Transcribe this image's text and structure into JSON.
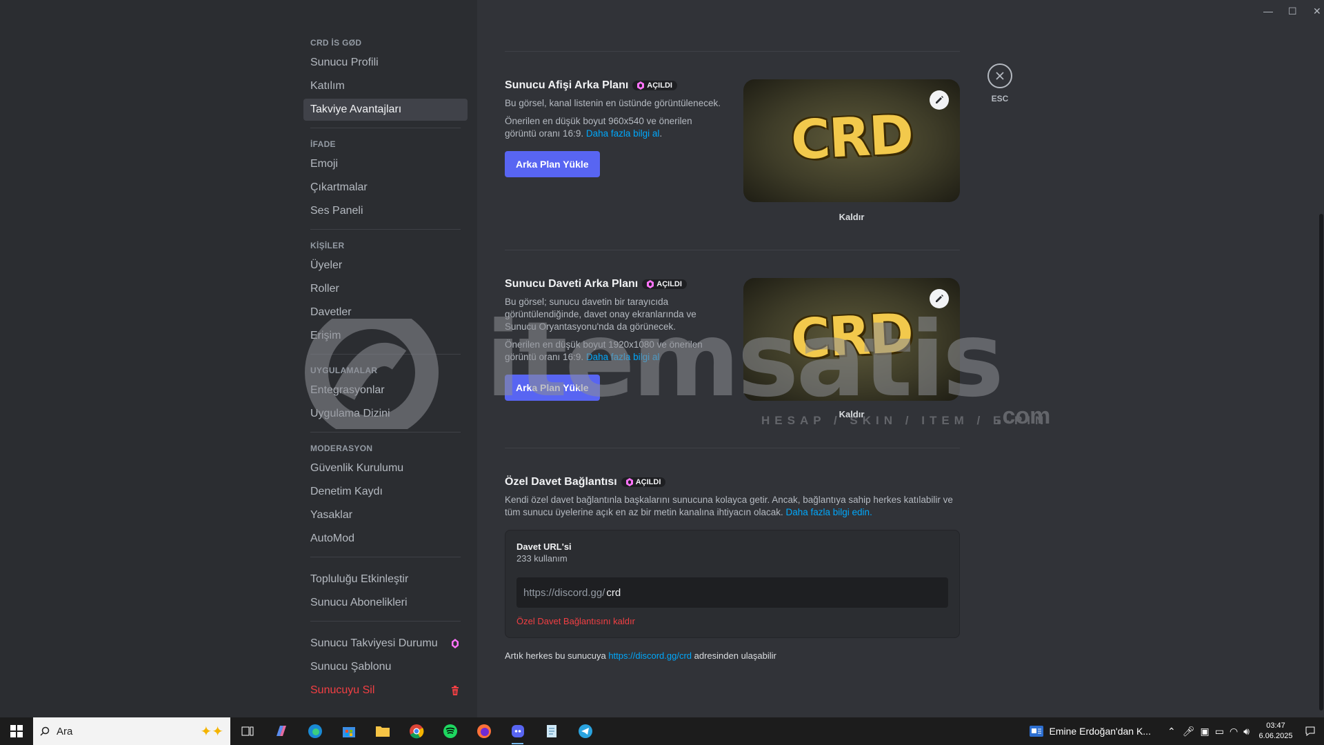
{
  "window": {
    "minimize": "—",
    "maximize": "☐",
    "close": "✕"
  },
  "sidebar": {
    "server_name": "CRD İS GØD",
    "group1": [
      "Sunucu Profili",
      "Katılım",
      "Takviye Avantajları"
    ],
    "section_expression": "İFADE",
    "group2": [
      "Emoji",
      "Çıkartmalar",
      "Ses Paneli"
    ],
    "section_people": "KİŞİLER",
    "group3": [
      "Üyeler",
      "Roller",
      "Davetler",
      "Erişim"
    ],
    "section_apps": "UYGULAMALAR",
    "group4": [
      "Entegrasyonlar",
      "Uygulama Dizini"
    ],
    "section_moderation": "MODERASYON",
    "group5": [
      "Güvenlik Kurulumu",
      "Denetim Kaydı",
      "Yasaklar",
      "AutoMod"
    ],
    "group6": [
      "Topluluğu Etkinleştir",
      "Sunucu Abonelikleri"
    ],
    "boost_status": "Sunucu Takviyesi Durumu",
    "template": "Sunucu Şablonu",
    "delete": "Sunucuyu Sil"
  },
  "banner_section": {
    "title": "Sunucu Afişi Arka Planı",
    "badge": "AÇILDI",
    "desc1": "Bu görsel, kanal listenin en üstünde görüntülenecek.",
    "desc2": "Önerilen en düşük boyut 960x540 ve önerilen görüntü oranı 16:9.",
    "link": "Daha fazla bilgi al",
    "link_suffix": ".",
    "button": "Arka Plan Yükle",
    "image_text": "CRD",
    "remove": "Kaldır"
  },
  "invite_bg_section": {
    "title": "Sunucu Daveti Arka Planı",
    "badge": "AÇILDI",
    "desc1": "Bu görsel; sunucu davetin bir tarayıcıda görüntülendiğinde, davet onay ekranlarında ve Sunucu Oryantasyonu'nda da görünecek.",
    "desc2": "Önerilen en düşük boyut 1920x1080 ve önerilen görüntü oranı 16:9.",
    "link": "Daha fazla bilgi al",
    "button": "Arka Plan Yükle",
    "image_text": "CRD",
    "remove": "Kaldır"
  },
  "vanity_section": {
    "title": "Özel Davet Bağlantısı",
    "badge": "AÇILDI",
    "desc": "Kendi özel davet bağlantınla başkalarını sunucuna kolayca getir. Ancak, bağlantıya sahip herkes katılabilir ve tüm sunucu üyelerine açık en az bir metin kanalına ihtiyacın olacak.",
    "link": "Daha fazla bilgi edin.",
    "box_title": "Davet URL'si",
    "uses": "233 kullanım",
    "prefix": "https://discord.gg/",
    "value": "crd",
    "remove_link": "Özel Davet Bağlantısını kaldır",
    "footer_pre": "Artık herkes bu sunucuya",
    "footer_url": "https://discord.gg/crd",
    "footer_post": "adresinden ulaşabilir"
  },
  "close": {
    "label": "ESC"
  },
  "watermark": {
    "brand": "itemsatis",
    "tagline": "HESAP / SKIN / ITEM / E-PIN",
    "suffix": ".com"
  },
  "taskbar": {
    "search_placeholder": "Ara",
    "news": "Emine Erdoğan'dan K...",
    "time": "03:47",
    "date": "6.06.2025"
  }
}
